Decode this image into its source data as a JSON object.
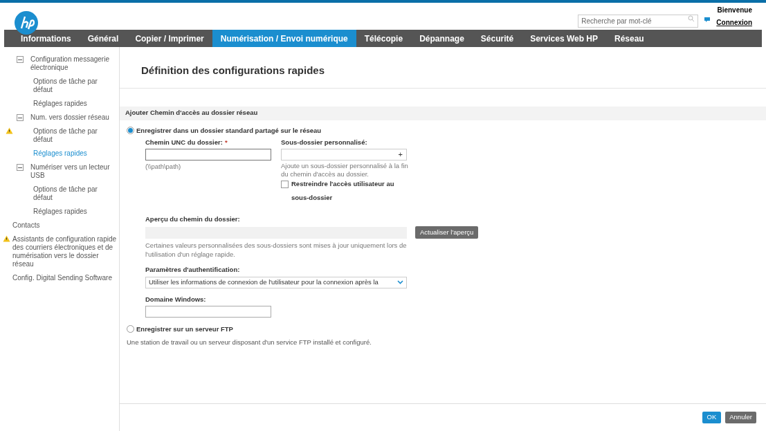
{
  "header": {
    "search": {
      "placeholder": "Recherche par mot-clé"
    },
    "welcome": "Bienvenue",
    "login": "Connexion"
  },
  "nav": [
    {
      "label": "Informations",
      "selected": false
    },
    {
      "label": "Général",
      "selected": false
    },
    {
      "label": "Copier / Imprimer",
      "selected": false
    },
    {
      "label": "Numérisation / Envoi numérique",
      "selected": true
    },
    {
      "label": "Télécopie",
      "selected": false
    },
    {
      "label": "Dépannage",
      "selected": false
    },
    {
      "label": "Sécurité",
      "selected": false
    },
    {
      "label": "Services Web HP",
      "selected": false
    },
    {
      "label": "Réseau",
      "selected": false
    }
  ],
  "sidebar": {
    "items": [
      {
        "label": "Configuration messagerie électronique",
        "expanded": true,
        "warning": false,
        "selected": false,
        "children": [
          {
            "label": "Options de tâche par défaut",
            "warning": false,
            "selected": false
          },
          {
            "label": "Réglages rapides",
            "warning": false,
            "selected": false
          }
        ]
      },
      {
        "label": "Num. vers dossier réseau",
        "expanded": true,
        "warning": false,
        "selected": false,
        "children": [
          {
            "label": "Options de tâche par défaut",
            "warning": true,
            "selected": false
          },
          {
            "label": "Réglages rapides",
            "warning": false,
            "selected": true
          }
        ]
      },
      {
        "label": "Numériser vers un lecteur USB",
        "expanded": true,
        "warning": false,
        "selected": false,
        "children": [
          {
            "label": "Options de tâche par défaut",
            "warning": false,
            "selected": false
          },
          {
            "label": "Réglages rapides",
            "warning": false,
            "selected": false
          }
        ]
      },
      {
        "label": "Contacts",
        "warning": false,
        "selected": false
      },
      {
        "label": "Assistants de configuration rapide des courriers électroniques et de numérisation vers le dossier réseau",
        "warning": true,
        "selected": false
      },
      {
        "label": "Config. Digital Sending Software",
        "warning": false,
        "selected": false
      }
    ]
  },
  "page": {
    "title": "Définition des configurations rapides",
    "section": "Ajouter Chemin d'accès au dossier réseau",
    "options": [
      {
        "label": "Enregistrer dans un dossier standard partagé sur le réseau",
        "selected": true
      },
      {
        "label": "Enregistrer sur un serveur FTP",
        "selected": false
      }
    ],
    "unc": {
      "label": "Chemin UNC du dossier:",
      "required_mark": "*",
      "hint": "(\\\\path\\path)"
    },
    "subfolder": {
      "label": "Sous-dossier personnalisé:",
      "add": "+",
      "hint": "Ajoute un sous-dossier personnalisé à la fin du chemin d'accès au dossier.",
      "restrict": {
        "label": "Restreindre l'accès utilisateur au sous-dossier",
        "checked": false
      }
    },
    "preview": {
      "label": "Aperçu du chemin du dossier:",
      "button": "Actualiser l'aperçu",
      "note": "Certaines valeurs personnalisées des sous-dossiers sont mises à jour uniquement lors de l'utilisation d'un réglage rapide."
    },
    "auth": {
      "label": "Paramètres d'authentification:",
      "value": "Utiliser les informations de connexion de l'utilisateur pour la connexion après la"
    },
    "domain": {
      "label": "Domaine Windows:"
    },
    "ftp_note": "Une station de travail ou un serveur disposant d'un service FTP installé et configuré."
  },
  "buttons": [
    {
      "label": "OK",
      "kind": "primary"
    },
    {
      "label": "Annuler",
      "kind": "secondary"
    }
  ]
}
